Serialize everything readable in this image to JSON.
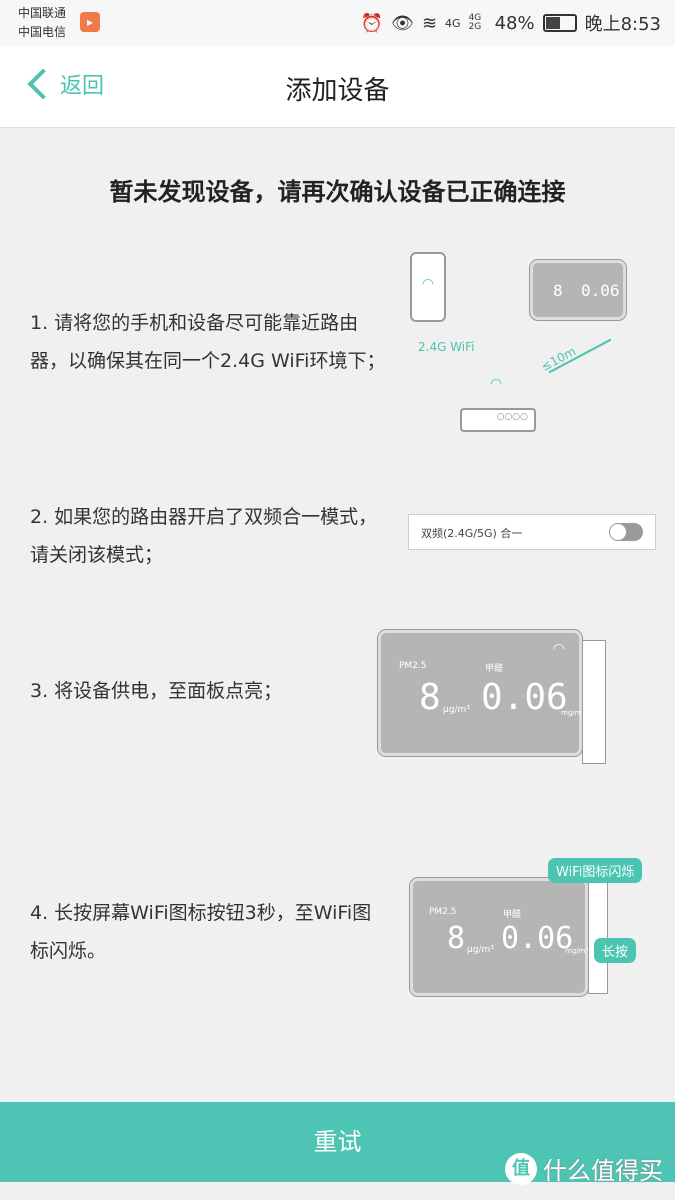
{
  "status": {
    "carrier1": "中国联通",
    "carrier2": "中国电信",
    "net1": "4G",
    "net2": "4G 2G",
    "battery": "48%",
    "battery_level": 0.48,
    "time": "晚上8:53"
  },
  "nav": {
    "back": "返回",
    "title": "添加设备"
  },
  "headline": "暂未发现设备，请再次确认设备已正确连接",
  "steps": [
    "1. 请将您的手机和设备尽可能靠近路由器，以确保其在同一个2.4G WiFi环境下；",
    "2. 如果您的路由器开启了双频合一模式，请关闭该模式；",
    "3. 将设备供电，至面板点亮；",
    "4. 长按屏幕WiFi图标按钮3秒，至WiFi图标闪烁。"
  ],
  "illustrations": {
    "wifi_label": "2.4G WiFi",
    "distance": "≤10m",
    "toggle_label": "双频(2.4G/5G) 合一",
    "toggle_on": false,
    "pm_label": "PM2.5",
    "pm_value": "8",
    "pm_unit": "μg/m³",
    "hcho_label": "甲醛",
    "hcho_value": "0.06",
    "hcho_unit": "mg/m³",
    "bubble_wifi": "WiFi图标闪烁",
    "bubble_press": "长按"
  },
  "retry": "重试",
  "watermark": "什么值得买",
  "watermark_icon": "值",
  "colors": {
    "accent": "#4ec5b4"
  }
}
